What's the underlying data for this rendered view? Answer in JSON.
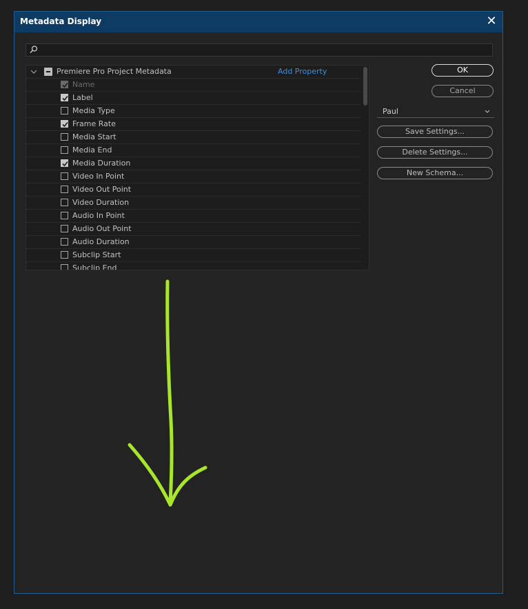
{
  "dialog": {
    "title": "Metadata Display",
    "close_glyph": "✕"
  },
  "search": {
    "value": "",
    "placeholder": ""
  },
  "group": {
    "label": "Premiere Pro Project Metadata",
    "add_property": "Add Property"
  },
  "items": [
    {
      "label": "Name",
      "state": "disabled"
    },
    {
      "label": "Label",
      "state": "checked"
    },
    {
      "label": "Media Type",
      "state": "unchecked"
    },
    {
      "label": "Frame Rate",
      "state": "checked"
    },
    {
      "label": "Media Start",
      "state": "unchecked"
    },
    {
      "label": "Media End",
      "state": "unchecked"
    },
    {
      "label": "Media Duration",
      "state": "checked"
    },
    {
      "label": "Video In Point",
      "state": "unchecked"
    },
    {
      "label": "Video Out Point",
      "state": "unchecked"
    },
    {
      "label": "Video Duration",
      "state": "unchecked"
    },
    {
      "label": "Audio In Point",
      "state": "unchecked"
    },
    {
      "label": "Audio Out Point",
      "state": "unchecked"
    },
    {
      "label": "Audio Duration",
      "state": "unchecked"
    },
    {
      "label": "Subclip Start",
      "state": "unchecked"
    },
    {
      "label": "Subclip End",
      "state": "unchecked"
    }
  ],
  "buttons": {
    "ok": "OK",
    "cancel": "Cancel",
    "save_settings": "Save Settings...",
    "delete_settings": "Delete Settings...",
    "new_schema": "New Schema..."
  },
  "settings_dropdown": {
    "selected": "Paul"
  },
  "colors": {
    "annotation_arrow": "#a8e62b",
    "title_bar": "#0d3b63",
    "link": "#3b8fe0"
  }
}
